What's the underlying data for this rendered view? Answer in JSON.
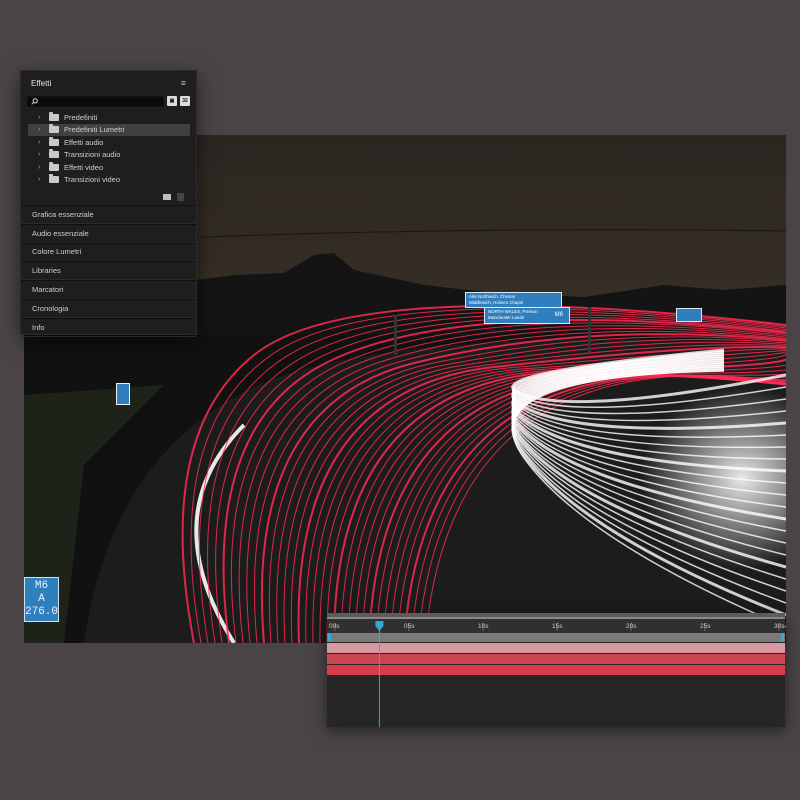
{
  "effects_panel": {
    "title": "Effetti",
    "menu_icon": "hamburger-menu-icon",
    "search": {
      "placeholder": "",
      "value": ""
    },
    "toolbar_icons": [
      "new-preset-bin-icon",
      "32-bit-filter-icon"
    ],
    "tree": [
      {
        "label": "Predefiniti",
        "selected": false
      },
      {
        "label": "Predefiniti Lumetri",
        "selected": true
      },
      {
        "label": "Effetti audio",
        "selected": false
      },
      {
        "label": "Transizioni audio",
        "selected": false
      },
      {
        "label": "Effetti video",
        "selected": false
      },
      {
        "label": "Transizioni video",
        "selected": false
      }
    ],
    "sections": [
      "Grafica essenziale",
      "Audio essenziale",
      "Colore Lumetri",
      "Libraries",
      "Marcatori",
      "Cronologia",
      "Info"
    ]
  },
  "photo": {
    "signs": [
      {
        "lines": [
          "A56 Northwich, Chester",
          "Middlewich, Holmes Chapel"
        ]
      },
      {
        "lines": [
          "NORTH WALES, Preston",
          "Manchester  Leeds"
        ],
        "badge": "M6"
      },
      {
        "lines": [
          "M6",
          "A",
          "276.0"
        ]
      }
    ],
    "colors": {
      "sign_blue": "#2f7fbf",
      "trail_red": "#ff2a52",
      "trail_white": "#ffffff"
    }
  },
  "timeline": {
    "ticks": [
      "00s",
      "05s",
      "10s",
      "15s",
      "20s",
      "25s",
      "30s"
    ],
    "playhead_seconds": 3,
    "duration_seconds": 30,
    "tracks": [
      {
        "color": "#d89aa0"
      },
      {
        "color": "#c94652"
      },
      {
        "color": "#d83c48"
      }
    ],
    "colors": {
      "playhead": "#2fa9d6",
      "range_bar": "#7a7a7a"
    }
  }
}
